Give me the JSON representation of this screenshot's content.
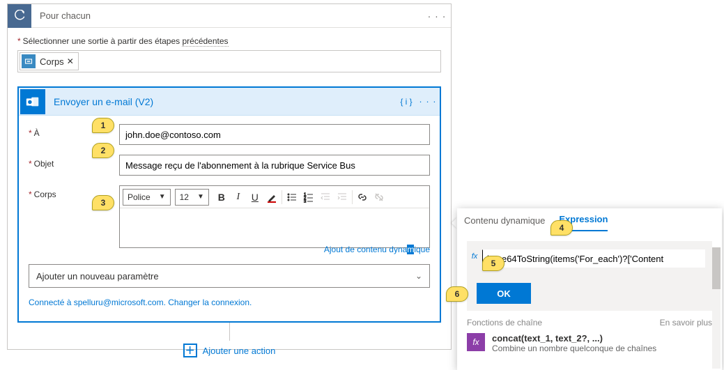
{
  "foreach": {
    "title": "Pour chacun",
    "select_output_label_pre": "Sélectionner une sortie à partir des étapes ",
    "select_output_label_dotted": "précédentes",
    "token_label": "Corps"
  },
  "email": {
    "title": "Envoyer un e-mail (V2)",
    "to_label": "À",
    "to_value": "john.doe@contoso.com",
    "subject_label": "Objet",
    "subject_value": "Message reçu de l'abonnement à la rubrique Service Bus",
    "body_label": "Corps",
    "font_label": "Police",
    "size_label": "12",
    "dyn_link_pre": "Ajout de contenu dyna",
    "dyn_link_hi": "m",
    "dyn_link_post": "ique",
    "add_param": "Ajouter un nouveau paramètre",
    "conn_info": "Connecté à spelluru@microsoft.com. Changer la connexion."
  },
  "add_action": "Ajouter une action",
  "expr": {
    "tab1": "Contenu dynamique",
    "tab2": "Expression",
    "input": "base64ToString(items('For_each')?['Content",
    "ok": "OK",
    "funcs_head": "Fonctions de chaîne",
    "learn_more": "En savoir plus",
    "concat_sig": "concat(text_1, text_2?, ...)",
    "concat_desc": "Combine un nombre quelconque de chaînes"
  },
  "badges": {
    "b1": "1",
    "b2": "2",
    "b3": "3",
    "b4": "4",
    "b5": "5",
    "b6": "6"
  }
}
